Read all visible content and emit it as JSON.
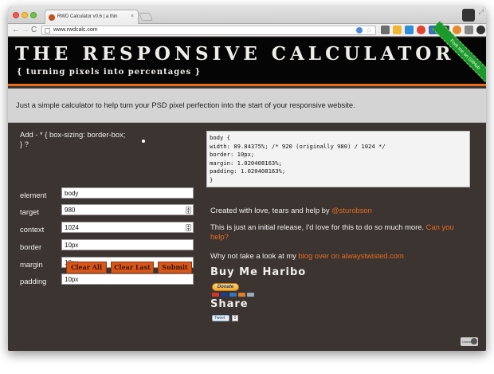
{
  "browser": {
    "tab_title": "RWD Calculator v0.6 | a thin",
    "tab_close": "×",
    "url": "www.rwdcalc.com",
    "back": "←",
    "forward": "→",
    "reload": "C",
    "maximize": "⤢"
  },
  "header": {
    "title": "THE RESPONSIVE CALCULATOR",
    "subtitle": "{ turning pixels into percentages }",
    "ribbon": "Fork me on GitHub"
  },
  "intro": "Just a simple calculator to help turn your PSD pixel perfection into the start of your responsive website.",
  "form": {
    "prompt": "Add - * { box-sizing: border-box; } ?",
    "fields": [
      {
        "label": "element",
        "value": "body"
      },
      {
        "label": "target",
        "value": "980"
      },
      {
        "label": "context",
        "value": "1024"
      },
      {
        "label": "border",
        "value": "10px"
      },
      {
        "label": "margin",
        "value": "10px"
      },
      {
        "label": "padding",
        "value": "10px"
      }
    ],
    "buttons": {
      "clear_all": "Clear All",
      "clear_last": "Clear Last",
      "submit": "Submit"
    }
  },
  "output": {
    "lines": [
      "body {",
      "width: 89.84375%; /* 920 (originally 980) / 1024 */",
      "border: 10px;",
      "margin: 1.020408163%;",
      "padding: 1.020408163%;",
      "}"
    ]
  },
  "credits": {
    "line1_text": "Created with love, tears and help by ",
    "line1_link": "@sturobson",
    "line2_text": "This is just an initial release, I'd love for this to do so much more. ",
    "line2_link": "Can you help?",
    "line3_text": "Why not take a look at my ",
    "line3_link": "blog over on alwaystwisted.com"
  },
  "haribo": {
    "title": "Buy Me Haribo",
    "donate": "Donate"
  },
  "share": {
    "title": "Share",
    "tweet": "Tweet",
    "count": "0"
  },
  "badge": "Overlay"
}
